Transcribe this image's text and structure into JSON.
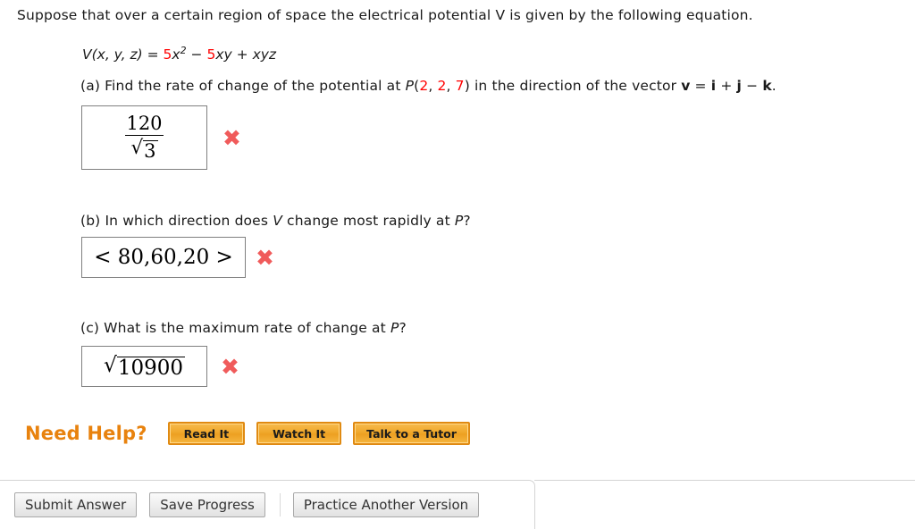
{
  "problem": {
    "statement": "Suppose that over a certain region of space the electrical potential V is given by the following equation.",
    "statement_variable": "V",
    "equation": {
      "lhs": "V(x, y, z)",
      "coefficient_1": "5",
      "term_1": "x",
      "exponent_1": "2",
      "operator_1": "−",
      "coefficient_2": "5",
      "term_2": "xy",
      "operator_2": "+",
      "term_3": "xyz"
    }
  },
  "parts": {
    "a": {
      "label_1": "(a) Find the rate of change of the potential at ",
      "point_name": "P",
      "point_open": "(",
      "point_x": "2",
      "point_sep1": ", ",
      "point_y": "2",
      "point_sep2": ", ",
      "point_z": "7",
      "point_close": ")",
      "label_2": " in the direction of the vector ",
      "vector_v": "v",
      "vector_eq": " = ",
      "vector_i": "i",
      "vector_plus": " + ",
      "vector_j": "j",
      "vector_minus": " − ",
      "vector_k": "k",
      "label_end": ".",
      "answer_numerator": "120",
      "answer_radical_sign": "√",
      "answer_denominator_radicand": "3",
      "status_icon": "✖",
      "status": "incorrect"
    },
    "b": {
      "label_1": "(b) In which direction does ",
      "label_variable": "V",
      "label_2": " change most rapidly at ",
      "label_point": "P",
      "label_end": "?",
      "answer": "< 80,60,20 >",
      "status_icon": "✖",
      "status": "incorrect"
    },
    "c": {
      "label_1": "(c) What is the maximum rate of change at ",
      "label_point": "P",
      "label_end": "?",
      "answer_radical_sign": "√",
      "answer_radicand": "10900",
      "status_icon": "✖",
      "status": "incorrect"
    }
  },
  "help": {
    "title": "Need Help?",
    "title_color": "#e8820e",
    "buttons": [
      {
        "label": "Read It"
      },
      {
        "label": "Watch It"
      },
      {
        "label": "Talk to a Tutor"
      }
    ]
  },
  "toolbar": {
    "submit_label": "Submit Answer",
    "save_label": "Save Progress",
    "practice_label": "Practice Another Version"
  }
}
